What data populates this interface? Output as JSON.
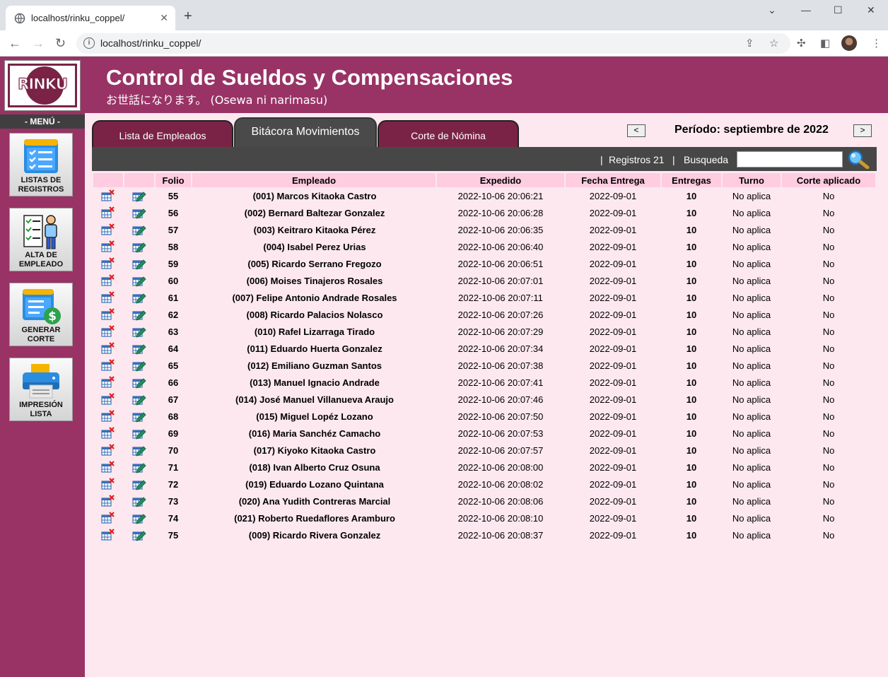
{
  "browser": {
    "tab_title": "localhost/rinku_coppel/",
    "url": "localhost/rinku_coppel/"
  },
  "app": {
    "logo_text": "RINKU",
    "title": "Control de Sueldos y Compensaciones",
    "subtitle": "お世話になります。 (Osewa ni narimasu)"
  },
  "sidebar": {
    "menu_label": "- MENÚ -",
    "items": [
      {
        "label": "LISTAS DE REGISTROS",
        "icon": "list-checklist-icon"
      },
      {
        "label": "ALTA DE EMPLEADO",
        "icon": "employee-checklist-icon"
      },
      {
        "label": "GENERAR CORTE",
        "icon": "list-dollar-icon"
      },
      {
        "label": "IMPRESIÓN LISTA",
        "icon": "printer-icon"
      }
    ]
  },
  "tabs": [
    {
      "label": "Lista de Empleados",
      "active": false
    },
    {
      "label": "Bitácora Movimientos",
      "active": true
    },
    {
      "label": "Corte de Nómina",
      "active": false
    }
  ],
  "period": {
    "label": "Período: septiembre de 2022",
    "prev": "<",
    "next": ">"
  },
  "toolbar": {
    "sep1": "|",
    "registros": "Registros 21",
    "sep2": "|",
    "busqueda": "Busqueda",
    "search_value": ""
  },
  "table": {
    "headers": [
      "",
      "",
      "Folio",
      "Empleado",
      "Expedido",
      "Fecha Entrega",
      "Entregas",
      "Turno",
      "Corte aplicado"
    ],
    "rows": [
      {
        "folio": "55",
        "empleado": "(001) Marcos Kitaoka Castro",
        "expedido": "2022-10-06 20:06:21",
        "fecha": "2022-09-01",
        "entregas": "10",
        "turno": "No aplica",
        "corte": "No"
      },
      {
        "folio": "56",
        "empleado": "(002) Bernard Baltezar Gonzalez",
        "expedido": "2022-10-06 20:06:28",
        "fecha": "2022-09-01",
        "entregas": "10",
        "turno": "No aplica",
        "corte": "No"
      },
      {
        "folio": "57",
        "empleado": "(003) Keitraro Kitaoka Pérez",
        "expedido": "2022-10-06 20:06:35",
        "fecha": "2022-09-01",
        "entregas": "10",
        "turno": "No aplica",
        "corte": "No"
      },
      {
        "folio": "58",
        "empleado": "(004) Isabel Perez Urias",
        "expedido": "2022-10-06 20:06:40",
        "fecha": "2022-09-01",
        "entregas": "10",
        "turno": "No aplica",
        "corte": "No"
      },
      {
        "folio": "59",
        "empleado": "(005) Ricardo Serrano Fregozo",
        "expedido": "2022-10-06 20:06:51",
        "fecha": "2022-09-01",
        "entregas": "10",
        "turno": "No aplica",
        "corte": "No"
      },
      {
        "folio": "60",
        "empleado": "(006) Moises Tinajeros Rosales",
        "expedido": "2022-10-06 20:07:01",
        "fecha": "2022-09-01",
        "entregas": "10",
        "turno": "No aplica",
        "corte": "No"
      },
      {
        "folio": "61",
        "empleado": "(007) Felipe Antonio Andrade Rosales",
        "expedido": "2022-10-06 20:07:11",
        "fecha": "2022-09-01",
        "entregas": "10",
        "turno": "No aplica",
        "corte": "No"
      },
      {
        "folio": "62",
        "empleado": "(008) Ricardo Palacios Nolasco",
        "expedido": "2022-10-06 20:07:26",
        "fecha": "2022-09-01",
        "entregas": "10",
        "turno": "No aplica",
        "corte": "No"
      },
      {
        "folio": "63",
        "empleado": "(010) Rafel Lizarraga Tirado",
        "expedido": "2022-10-06 20:07:29",
        "fecha": "2022-09-01",
        "entregas": "10",
        "turno": "No aplica",
        "corte": "No"
      },
      {
        "folio": "64",
        "empleado": "(011) Eduardo Huerta Gonzalez",
        "expedido": "2022-10-06 20:07:34",
        "fecha": "2022-09-01",
        "entregas": "10",
        "turno": "No aplica",
        "corte": "No"
      },
      {
        "folio": "65",
        "empleado": "(012) Emiliano Guzman Santos",
        "expedido": "2022-10-06 20:07:38",
        "fecha": "2022-09-01",
        "entregas": "10",
        "turno": "No aplica",
        "corte": "No"
      },
      {
        "folio": "66",
        "empleado": "(013) Manuel Ignacio Andrade",
        "expedido": "2022-10-06 20:07:41",
        "fecha": "2022-09-01",
        "entregas": "10",
        "turno": "No aplica",
        "corte": "No"
      },
      {
        "folio": "67",
        "empleado": "(014) José Manuel Villanueva Araujo",
        "expedido": "2022-10-06 20:07:46",
        "fecha": "2022-09-01",
        "entregas": "10",
        "turno": "No aplica",
        "corte": "No"
      },
      {
        "folio": "68",
        "empleado": "(015) Miguel Lopéz Lozano",
        "expedido": "2022-10-06 20:07:50",
        "fecha": "2022-09-01",
        "entregas": "10",
        "turno": "No aplica",
        "corte": "No"
      },
      {
        "folio": "69",
        "empleado": "(016) Maria Sanchéz Camacho",
        "expedido": "2022-10-06 20:07:53",
        "fecha": "2022-09-01",
        "entregas": "10",
        "turno": "No aplica",
        "corte": "No"
      },
      {
        "folio": "70",
        "empleado": "(017) Kiyoko Kitaoka Castro",
        "expedido": "2022-10-06 20:07:57",
        "fecha": "2022-09-01",
        "entregas": "10",
        "turno": "No aplica",
        "corte": "No"
      },
      {
        "folio": "71",
        "empleado": "(018) Ivan Alberto Cruz Osuna",
        "expedido": "2022-10-06 20:08:00",
        "fecha": "2022-09-01",
        "entregas": "10",
        "turno": "No aplica",
        "corte": "No"
      },
      {
        "folio": "72",
        "empleado": "(019) Eduardo Lozano Quintana",
        "expedido": "2022-10-06 20:08:02",
        "fecha": "2022-09-01",
        "entregas": "10",
        "turno": "No aplica",
        "corte": "No"
      },
      {
        "folio": "73",
        "empleado": "(020) Ana Yudith Contreras Marcial",
        "expedido": "2022-10-06 20:08:06",
        "fecha": "2022-09-01",
        "entregas": "10",
        "turno": "No aplica",
        "corte": "No"
      },
      {
        "folio": "74",
        "empleado": "(021) Roberto Ruedaflores Aramburo",
        "expedido": "2022-10-06 20:08:10",
        "fecha": "2022-09-01",
        "entregas": "10",
        "turno": "No aplica",
        "corte": "No"
      },
      {
        "folio": "75",
        "empleado": "(009) Ricardo Rivera Gonzalez",
        "expedido": "2022-10-06 20:08:37",
        "fecha": "2022-09-01",
        "entregas": "10",
        "turno": "No aplica",
        "corte": "No"
      }
    ]
  },
  "colors": {
    "brand": "#993366",
    "brand_dark": "#7a2346",
    "content_bg": "#fde8f0",
    "header_cell": "#ffcce0",
    "toolbar_bg": "#474747"
  }
}
